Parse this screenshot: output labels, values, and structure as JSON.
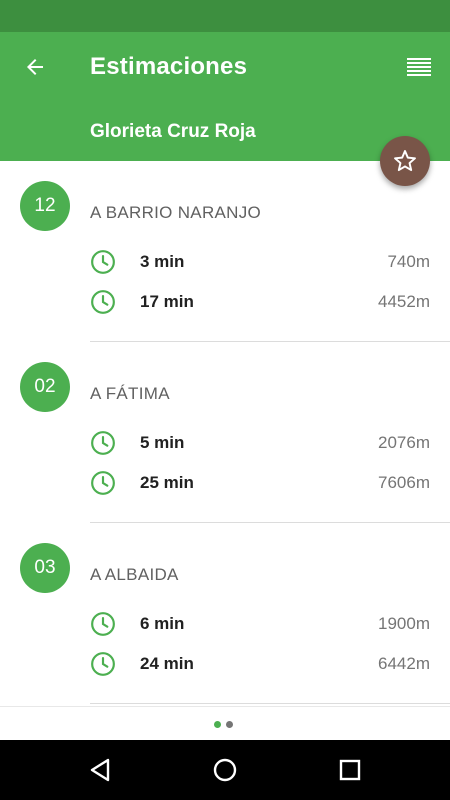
{
  "header": {
    "title": "Estimaciones",
    "subtitle": "Glorieta Cruz Roja"
  },
  "icons": {
    "back": "arrow-left-icon",
    "menu": "list-icon",
    "favorite": "star-outline-icon",
    "clock": "clock-icon"
  },
  "colors": {
    "primary": "#4caf50",
    "primary_dark": "#3d8f3f",
    "accent": "#795548"
  },
  "routes": [
    {
      "line": "12",
      "destination": "A BARRIO NARANJO",
      "estimates": [
        {
          "time": "3 min",
          "distance": "740m"
        },
        {
          "time": "17 min",
          "distance": "4452m"
        }
      ]
    },
    {
      "line": "02",
      "destination": "A FÁTIMA",
      "estimates": [
        {
          "time": "5 min",
          "distance": "2076m"
        },
        {
          "time": "25 min",
          "distance": "7606m"
        }
      ]
    },
    {
      "line": "03",
      "destination": "A ALBAIDA",
      "estimates": [
        {
          "time": "6 min",
          "distance": "1900m"
        },
        {
          "time": "24 min",
          "distance": "6442m"
        }
      ]
    }
  ],
  "pager": {
    "pages": 2,
    "current": 1
  }
}
